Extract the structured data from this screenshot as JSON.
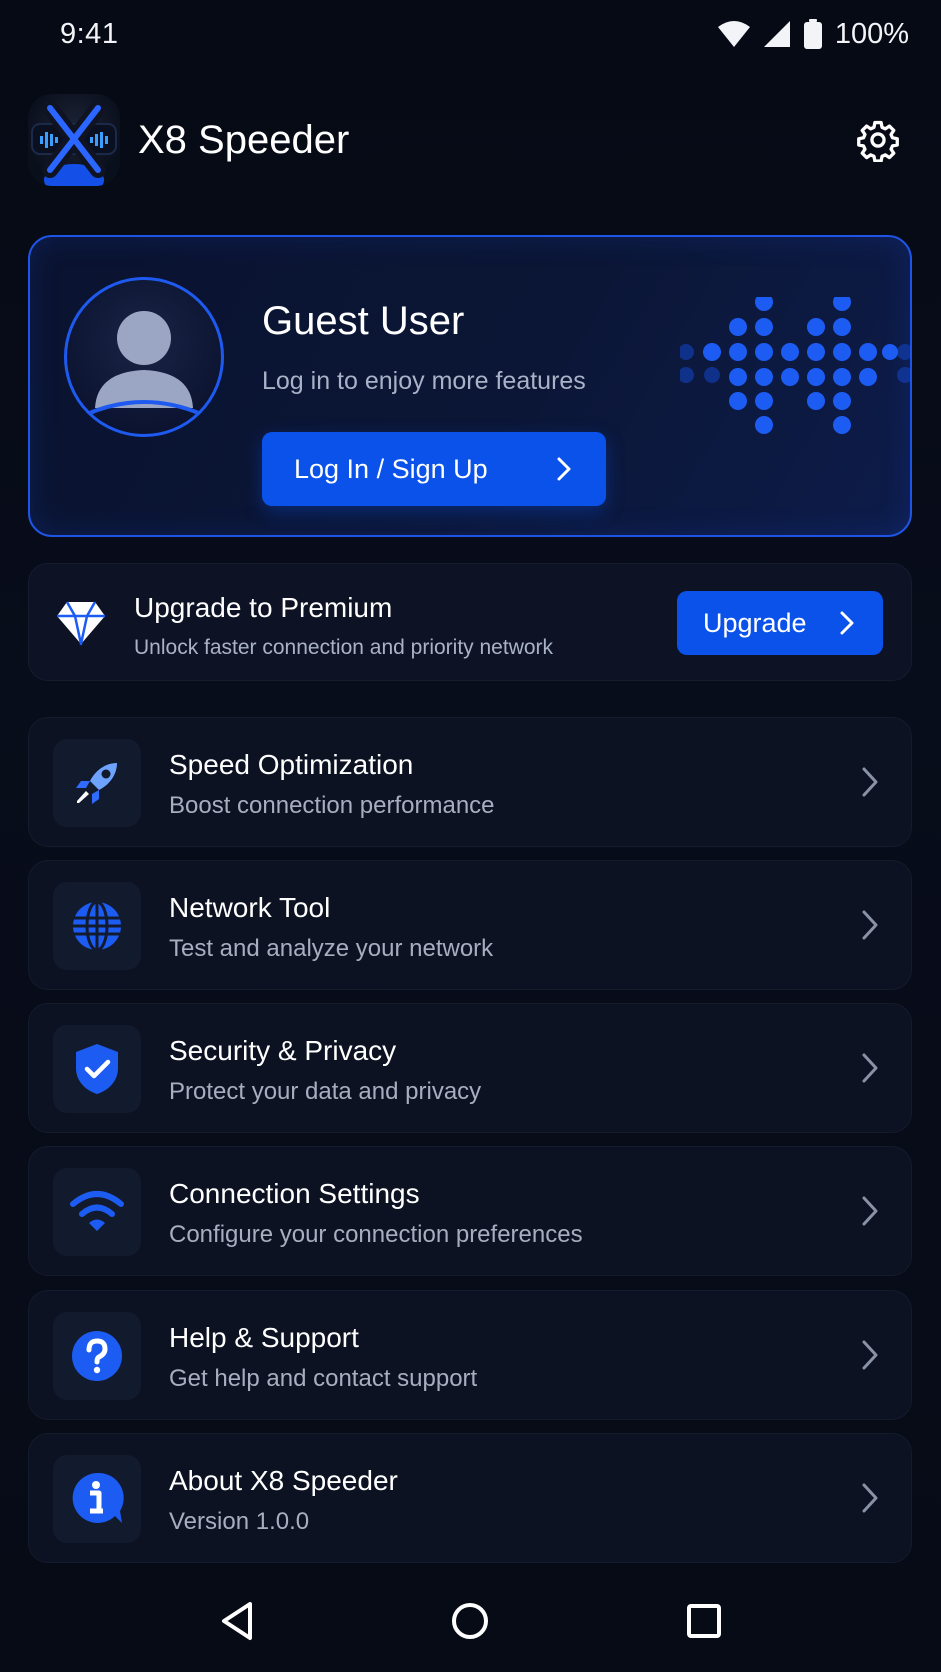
{
  "status_bar": {
    "time": "9:41",
    "battery_text": "100%",
    "icons": [
      "wifi-icon",
      "cellular-signal-icon",
      "battery-icon"
    ]
  },
  "header": {
    "app_name": "X8 Speeder",
    "logo": "x8-logo-icon",
    "settings_icon": "gear-icon"
  },
  "profile": {
    "name": "Guest User",
    "subtitle": "Log in to enjoy more features",
    "login_button": "Log In / Sign Up"
  },
  "premium": {
    "title": "Upgrade to Premium",
    "subtitle": "Unlock faster connection and priority network",
    "button": "Upgrade",
    "icon": "diamond-icon"
  },
  "menu": [
    {
      "title": "Speed Optimization",
      "subtitle": "Boost connection performance",
      "icon": "rocket-icon"
    },
    {
      "title": "Network Tool",
      "subtitle": "Test and analyze your network",
      "icon": "globe-icon"
    },
    {
      "title": "Security & Privacy",
      "subtitle": "Protect your data and privacy",
      "icon": "shield-check-icon"
    },
    {
      "title": "Connection Settings",
      "subtitle": "Configure your connection preferences",
      "icon": "wifi-icon"
    },
    {
      "title": "Help & Support",
      "subtitle": "Get help and contact support",
      "icon": "help-icon"
    },
    {
      "title": "About X8 Speeder",
      "subtitle": "Version 1.0.0",
      "icon": "info-icon"
    }
  ],
  "nav_bar": {
    "buttons": [
      "back-icon",
      "home-icon",
      "recents-icon"
    ]
  },
  "colors": {
    "background": "#070b16",
    "accent": "#0b52ea",
    "card": "#0c1222",
    "secondary_text": "#a9b2c6"
  }
}
